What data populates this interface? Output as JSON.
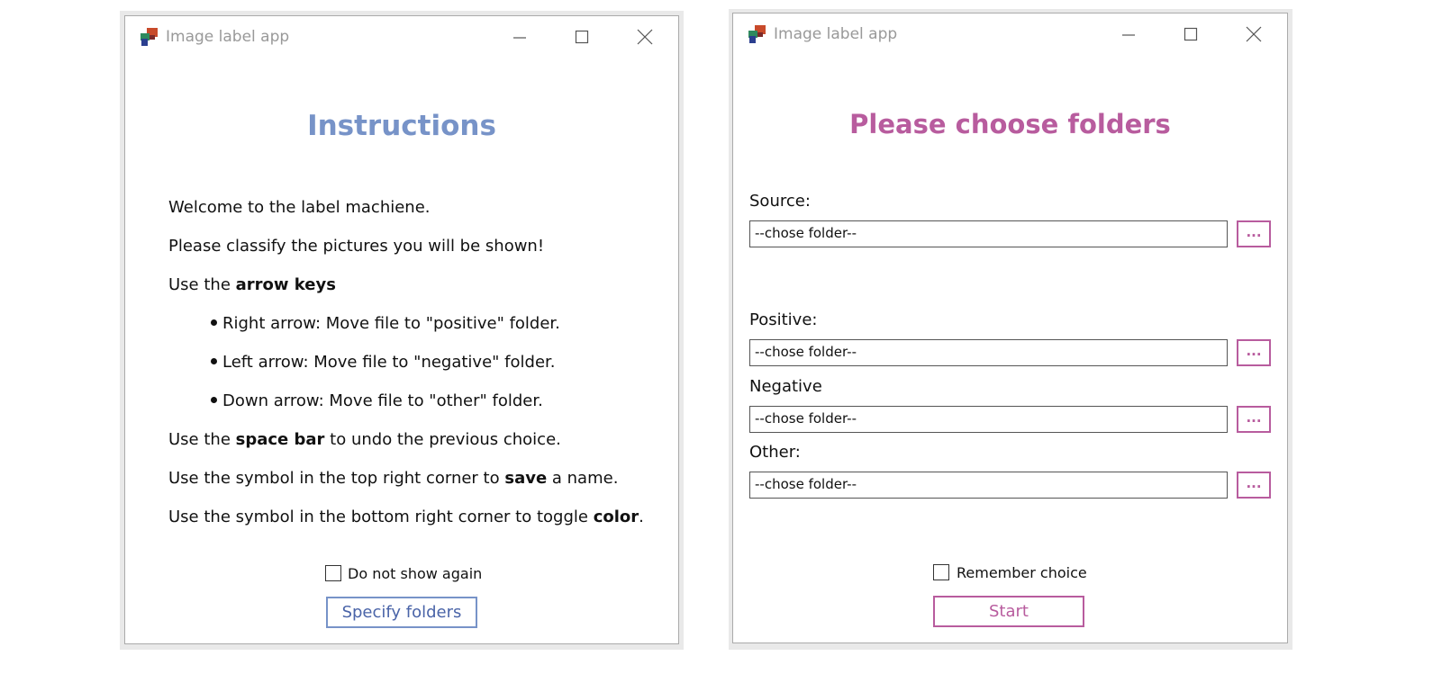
{
  "colors": {
    "instructions_accent": "#7793c8",
    "folders_accent": "#b85c9e",
    "title_gray": "#999999"
  },
  "left_window": {
    "title": "Image label app",
    "heading": "Instructions",
    "lines": {
      "welcome": "Welcome to the label machiene.",
      "classify": "Please classify the pictures you will be shown!",
      "arrow_prefix": "Use the ",
      "arrow_bold": "arrow keys",
      "bullet_right": "Right arrow: Move file to \"positive\" folder.",
      "bullet_left": "Left arrow: Move file to \"negative\" folder.",
      "bullet_down": "Down arrow: Move file to \"other\" folder.",
      "space_prefix": "Use the ",
      "space_bold": "space bar",
      "space_suffix": " to undo the previous choice.",
      "save_prefix": "Use the symbol in the top right corner to ",
      "save_bold": "save",
      "save_suffix": " a name.",
      "color_prefix": "Use the symbol in the bottom right corner to toggle ",
      "color_bold": "color",
      "color_suffix": "."
    },
    "checkbox_label": "Do not show again",
    "button_label": "Specify folders"
  },
  "right_window": {
    "title": "Image label app",
    "heading": "Please choose folders",
    "fields": {
      "source": {
        "label": "Source:",
        "value": "--chose folder--"
      },
      "positive": {
        "label": "Positive:",
        "value": "--chose folder--"
      },
      "negative": {
        "label": "Negative",
        "value": "--chose folder--"
      },
      "other": {
        "label": "Other:",
        "value": "--chose folder--"
      }
    },
    "browse_label": "...",
    "checkbox_label": "Remember choice",
    "button_label": "Start"
  }
}
